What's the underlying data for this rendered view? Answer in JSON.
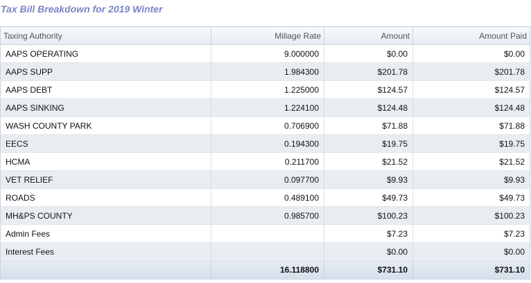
{
  "title": "Tax Bill Breakdown for 2019 Winter",
  "table": {
    "headers": {
      "authority": "Taxing Authority",
      "millage": "Millage Rate",
      "amount": "Amount",
      "paid": "Amount Paid"
    },
    "rows": [
      {
        "authority": "AAPS OPERATING",
        "millage": "9.000000",
        "amount": "$0.00",
        "paid": "$0.00"
      },
      {
        "authority": "AAPS SUPP",
        "millage": "1.984300",
        "amount": "$201.78",
        "paid": "$201.78"
      },
      {
        "authority": "AAPS DEBT",
        "millage": "1.225000",
        "amount": "$124.57",
        "paid": "$124.57"
      },
      {
        "authority": "AAPS SINKING",
        "millage": "1.224100",
        "amount": "$124.48",
        "paid": "$124.48"
      },
      {
        "authority": "WASH COUNTY PARK",
        "millage": "0.706900",
        "amount": "$71.88",
        "paid": "$71.88"
      },
      {
        "authority": "EECS",
        "millage": "0.194300",
        "amount": "$19.75",
        "paid": "$19.75"
      },
      {
        "authority": "HCMA",
        "millage": "0.211700",
        "amount": "$21.52",
        "paid": "$21.52"
      },
      {
        "authority": "VET RELIEF",
        "millage": "0.097700",
        "amount": "$9.93",
        "paid": "$9.93"
      },
      {
        "authority": "ROADS",
        "millage": "0.489100",
        "amount": "$49.73",
        "paid": "$49.73"
      },
      {
        "authority": "MH&PS COUNTY",
        "millage": "0.985700",
        "amount": "$100.23",
        "paid": "$100.23"
      },
      {
        "authority": "Admin Fees",
        "millage": "",
        "amount": "$7.23",
        "paid": "$7.23"
      },
      {
        "authority": "Interest Fees",
        "millage": "",
        "amount": "$0.00",
        "paid": "$0.00"
      }
    ],
    "totals": {
      "authority": "",
      "millage": "16.118800",
      "amount": "$731.10",
      "paid": "$731.10"
    }
  }
}
